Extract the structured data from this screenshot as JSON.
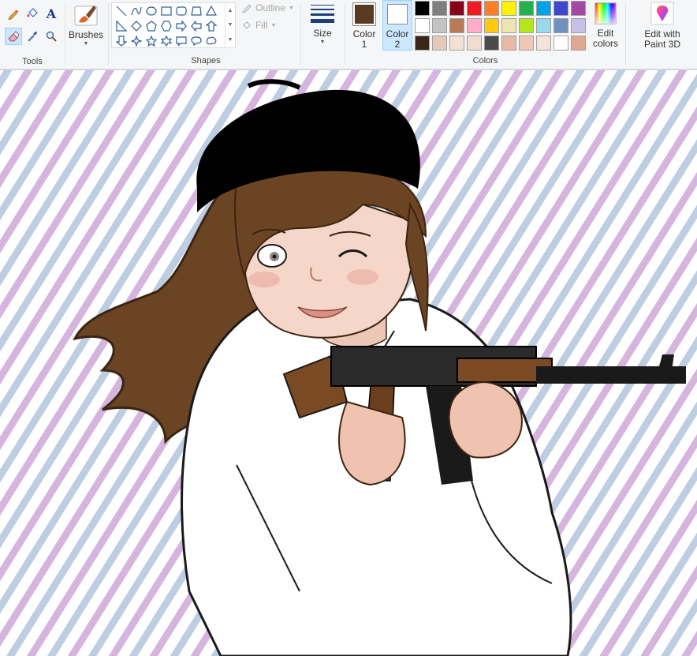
{
  "tools": {
    "label": "Tools",
    "text_glyph": "A"
  },
  "brushes": {
    "label": "Brushes"
  },
  "shapes": {
    "label": "Shapes",
    "outline_label": "Outline",
    "fill_label": "Fill"
  },
  "size": {
    "label": "Size"
  },
  "colors": {
    "label": "Colors",
    "color1_label": "Color\n1",
    "color2_label": "Color\n2",
    "color1": "#5a3a22",
    "color2": "#ffffff",
    "edit_label": "Edit\ncolors",
    "palette": [
      "#000000",
      "#7f7f7f",
      "#880015",
      "#ed1c24",
      "#ff7f27",
      "#fff200",
      "#22b14c",
      "#00a2e8",
      "#3f48cc",
      "#a349a4",
      "#ffffff",
      "#c3c3c3",
      "#b97a57",
      "#ffaec9",
      "#ffc90e",
      "#efe4b0",
      "#b5e61d",
      "#99d9ea",
      "#7092be",
      "#c8bfe7",
      "#3a2518",
      "#e6c8b8",
      "#f2e2d6",
      "#f0dcd0",
      "#4a4a4a",
      "#e8b9a4",
      "#efc7b6",
      "#f5e3da",
      "#ffffff",
      "#e0a890"
    ]
  },
  "paint3d": {
    "label": "Edit with\nPaint 3D"
  }
}
